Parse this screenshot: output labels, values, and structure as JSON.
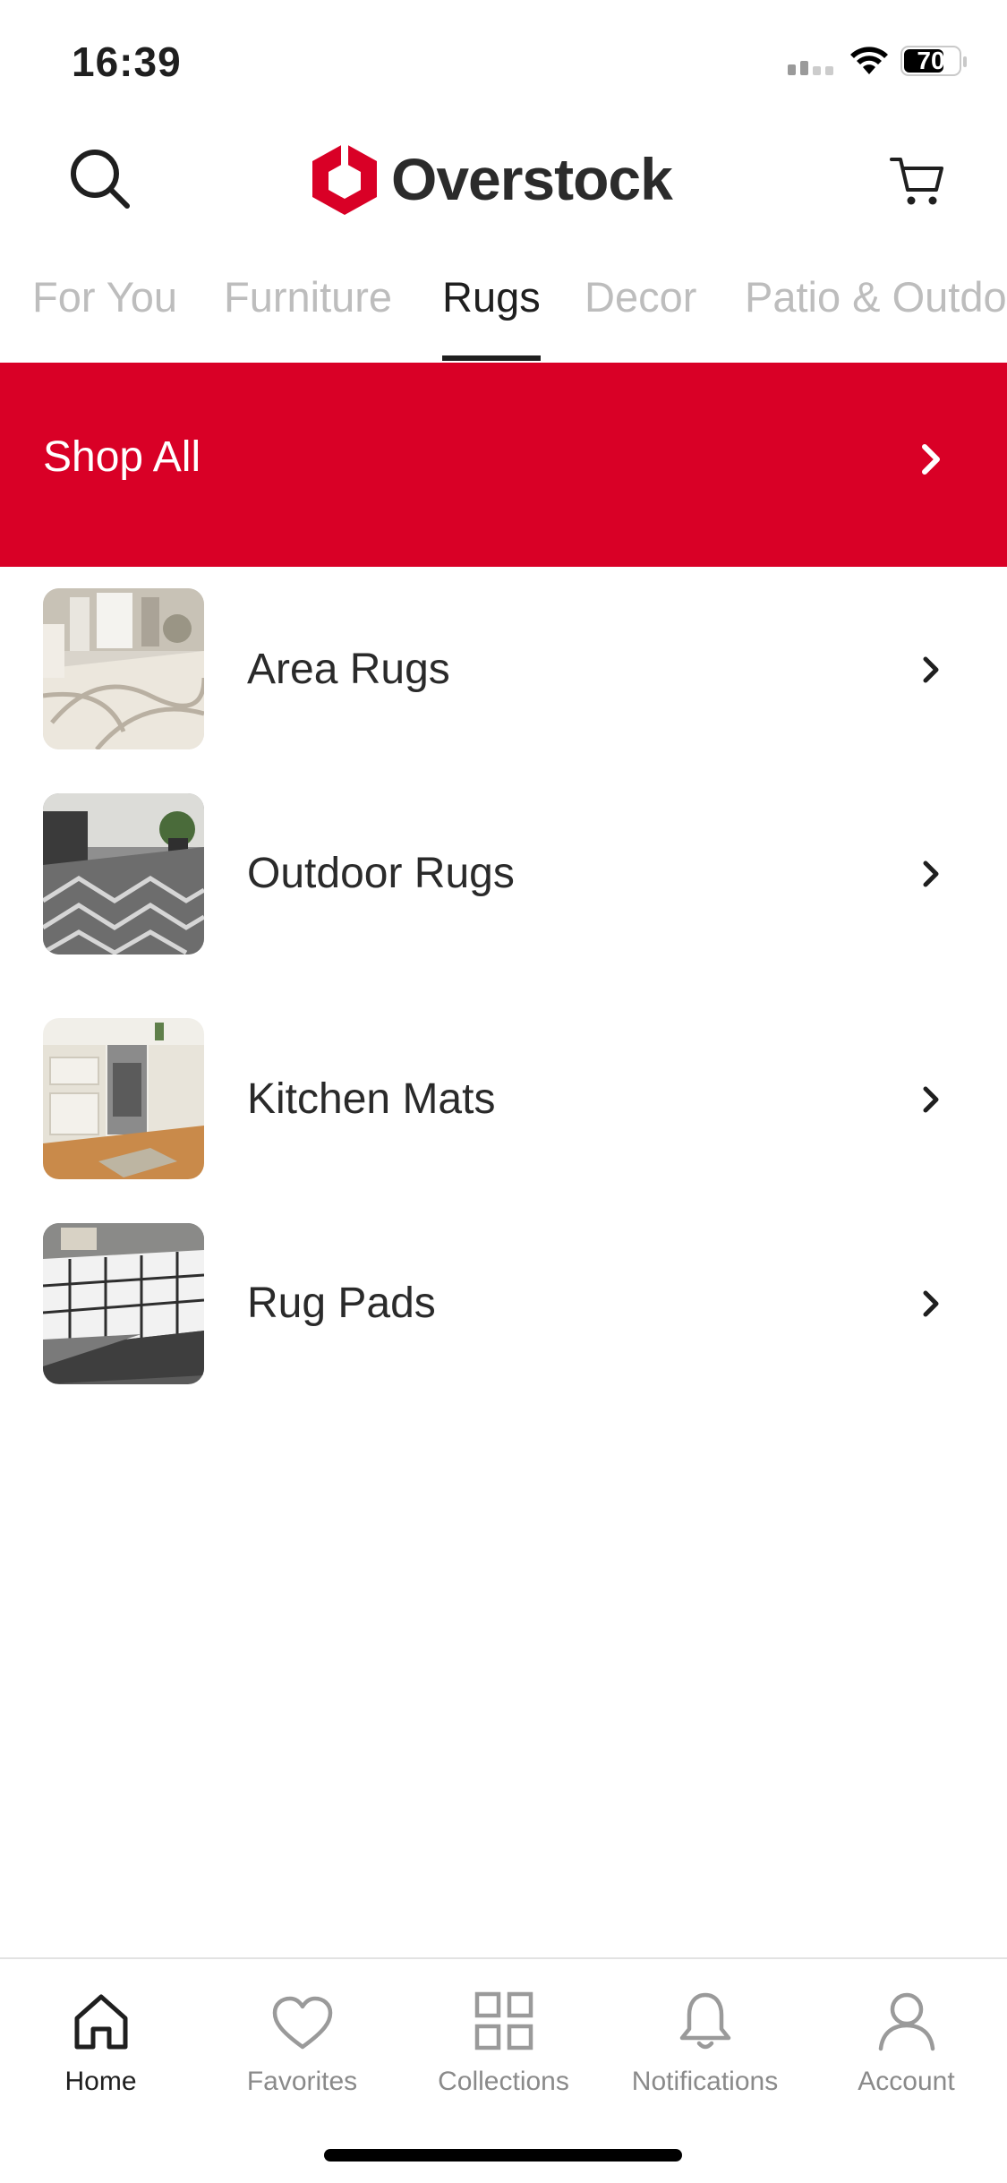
{
  "status_bar": {
    "time": "16:39",
    "battery": "70"
  },
  "header": {
    "brand": "Overstock",
    "brand_color": "#d90026",
    "search_icon": "search-icon",
    "cart_icon": "cart-icon"
  },
  "category_tabs": [
    {
      "label": "For You"
    },
    {
      "label": "Furniture"
    },
    {
      "label": "Rugs",
      "active": true
    },
    {
      "label": "Decor"
    },
    {
      "label": "Patio & Outdoor"
    }
  ],
  "shop_all": {
    "label": "Shop All",
    "icon": "chevron-right-icon"
  },
  "categories": [
    {
      "label": "Area Rugs",
      "icon": "chevron-right-icon"
    },
    {
      "label": "Outdoor Rugs",
      "icon": "chevron-right-icon"
    },
    {
      "label": "Kitchen Mats",
      "icon": "chevron-right-icon"
    },
    {
      "label": "Rug Pads",
      "icon": "chevron-right-icon"
    }
  ],
  "tab_bar": [
    {
      "label": "Home",
      "icon": "home-icon",
      "active": true
    },
    {
      "label": "Favorites",
      "icon": "heart-icon"
    },
    {
      "label": "Collections",
      "icon": "grid-icon"
    },
    {
      "label": "Notifications",
      "icon": "bell-icon"
    },
    {
      "label": "Account",
      "icon": "person-icon"
    }
  ]
}
